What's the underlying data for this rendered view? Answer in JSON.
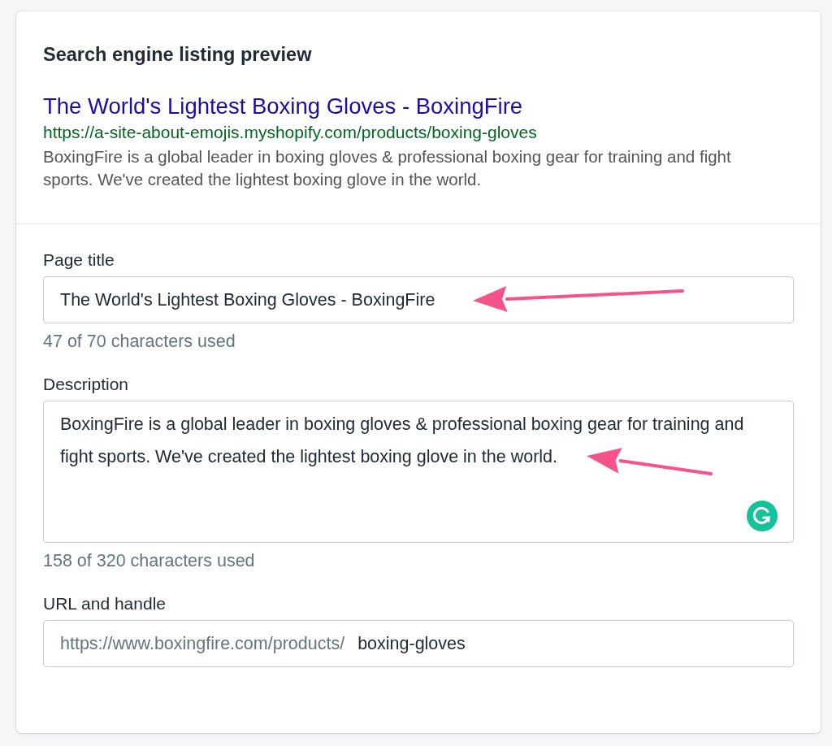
{
  "card": {
    "title": "Search engine listing preview"
  },
  "preview": {
    "title": "The World's Lightest Boxing Gloves - BoxingFire",
    "url": "https://a-site-about-emojis.myshopify.com/products/boxing-gloves",
    "description": "BoxingFire is a global leader in boxing gloves & professional boxing gear for training and fight sports. We've created the lightest boxing glove in the world."
  },
  "fields": [
    {
      "kind": "text",
      "label": "Page title",
      "value": "The World's Lightest Boxing Gloves - BoxingFire",
      "help": "47 of 70 characters used",
      "arrow": true
    },
    {
      "kind": "multiline",
      "label": "Description",
      "value": "BoxingFire is a global leader in boxing gloves & professional boxing gear for training and fight sports. We've created the lightest boxing glove in the world.",
      "help": "158 of 320 characters used",
      "arrow": true
    },
    {
      "kind": "url",
      "label": "URL and handle",
      "prefix": "https://www.boxingfire.com/products/",
      "value": "boxing-gloves",
      "arrow": false
    }
  ]
}
